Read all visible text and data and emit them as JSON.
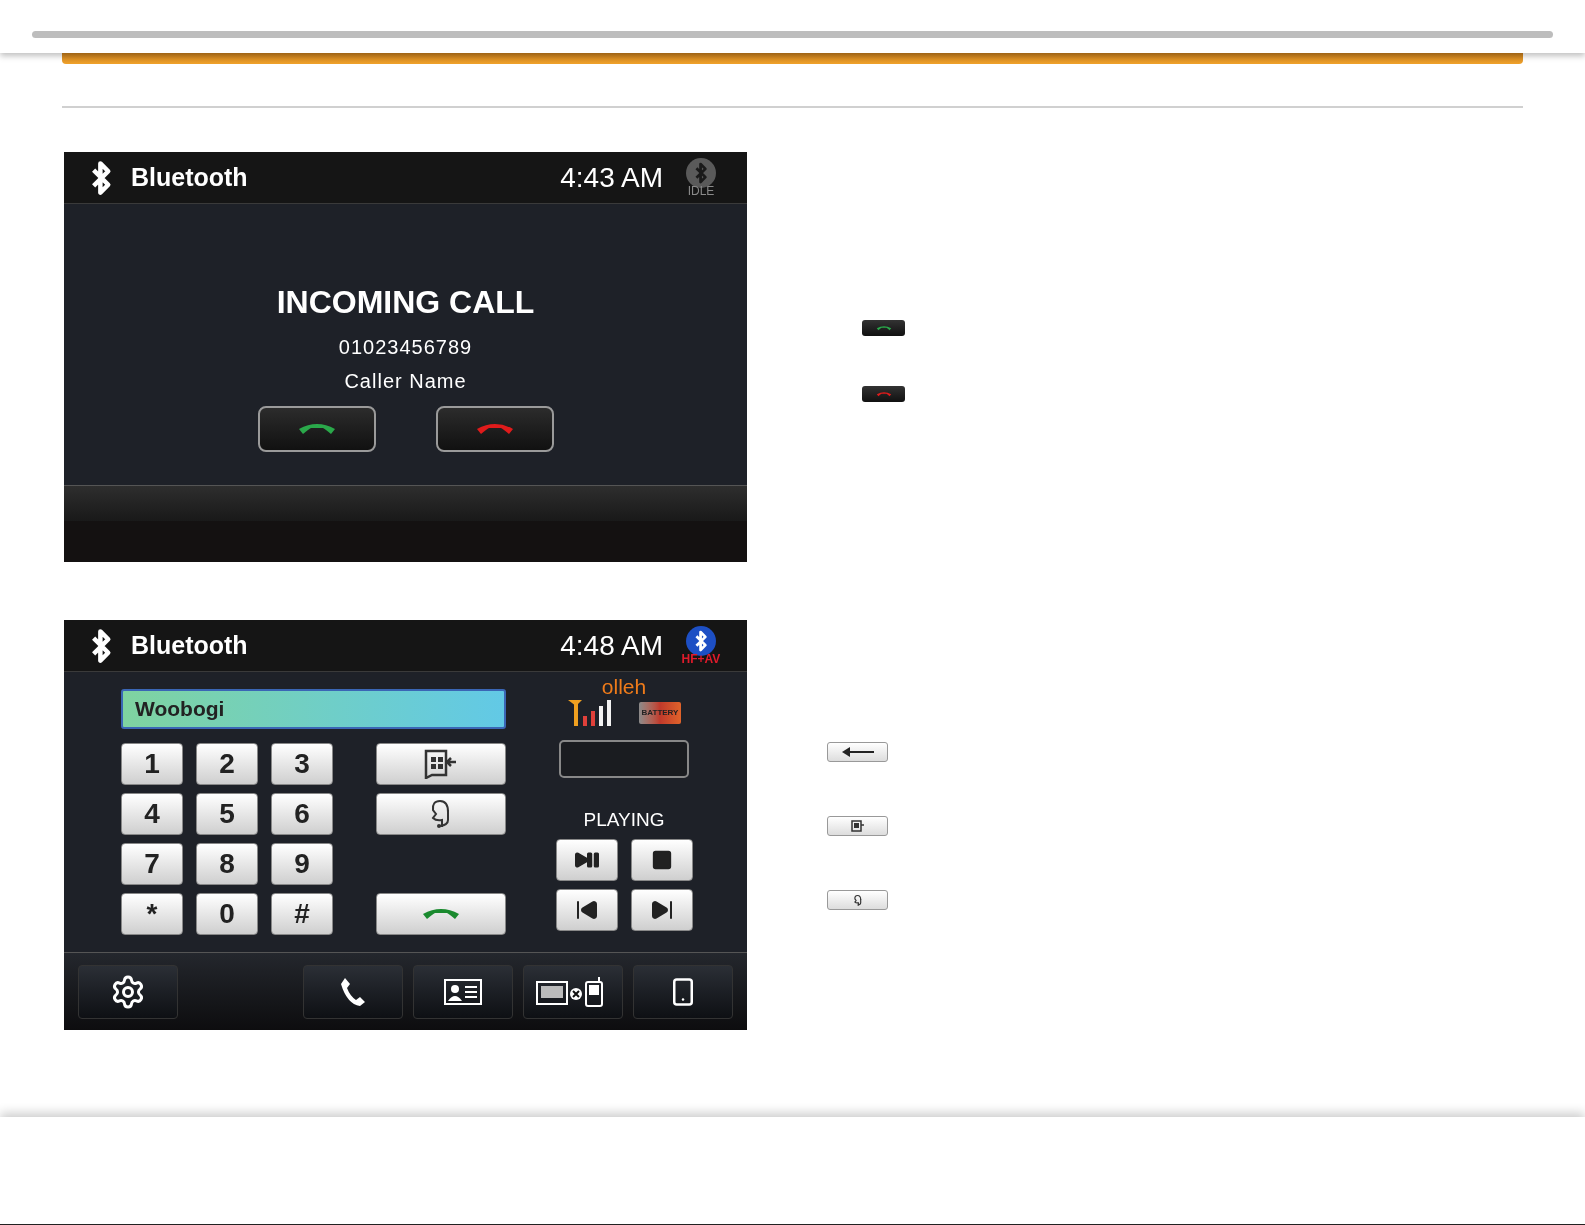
{
  "incoming_screen": {
    "header": {
      "title": "Bluetooth",
      "time": "4:43 AM",
      "status_label": "IDLE"
    },
    "heading": "INCOMING CALL",
    "number": "01023456789",
    "caller": "Caller Name"
  },
  "dialer_screen": {
    "header": {
      "title": "Bluetooth",
      "time": "4:48 AM",
      "status_label": "HF+AV"
    },
    "name_display": "Woobogi",
    "operator": "olleh",
    "battery_label": "BATTERY",
    "keypad": [
      "1",
      "2",
      "3",
      "4",
      "5",
      "6",
      "7",
      "8",
      "9",
      "*",
      "0",
      "#"
    ],
    "media_status": "PLAYING"
  }
}
